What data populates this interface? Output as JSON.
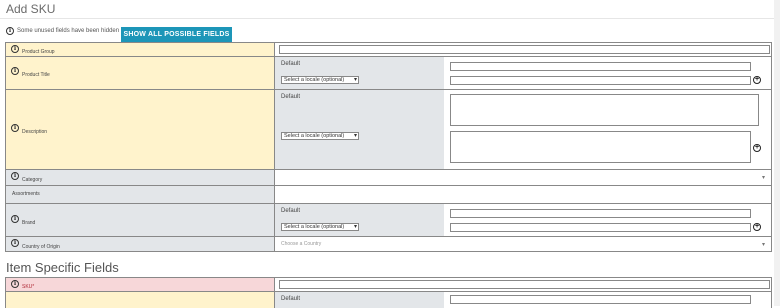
{
  "page": {
    "title": "Add SKU"
  },
  "hint": {
    "text": "Some unused fields have been hidden",
    "button": "SHOW ALL POSSIBLE FIELDS"
  },
  "fields": {
    "product_group": "Product Group",
    "product_title": "Product Title",
    "description": "Description",
    "category": "Category",
    "assortments": "Assortments",
    "brand": "Brand",
    "country": "Country of Origin",
    "sku": "SKU*"
  },
  "common": {
    "default_label": "Default",
    "locale_select": "Select a locale (optional)"
  },
  "country_placeholder": "Choose a Country",
  "section": {
    "title": "Item Specific Fields"
  },
  "colors": {
    "accent": "#1d96b8",
    "yellow": "#fff3cc",
    "gray": "#e3e6e9",
    "pink": "#f7d7d9"
  }
}
